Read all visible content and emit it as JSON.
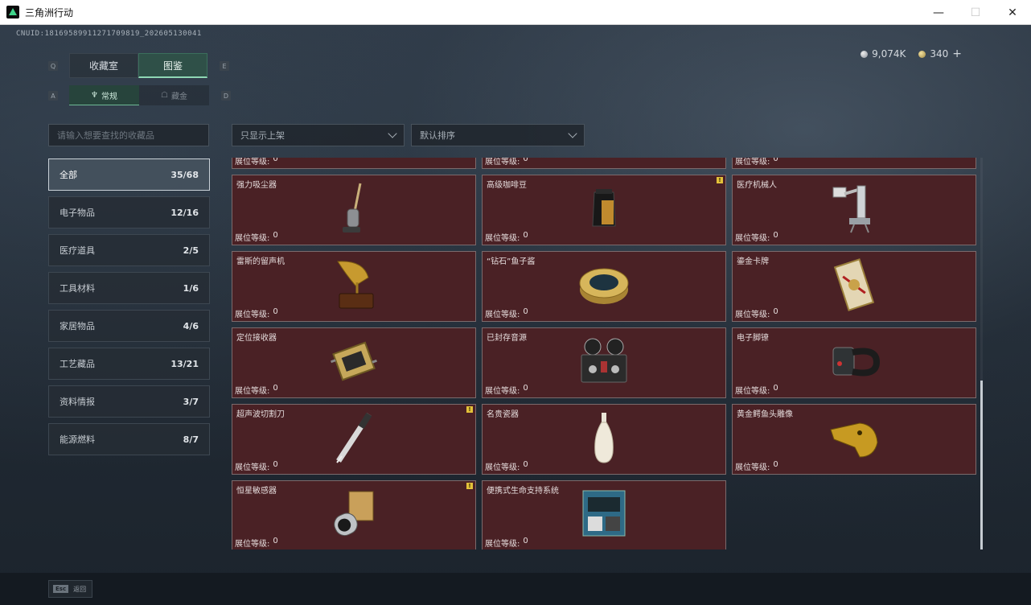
{
  "window": {
    "title": "三角洲行动",
    "minimize": "—",
    "maximize": "☐",
    "close": "✕"
  },
  "header": {
    "uid": "CNUID:18169589911271709819_202605130041"
  },
  "currency": {
    "silver": "9,074K",
    "gold": "340",
    "plus": "+"
  },
  "main_tabs": {
    "left_key": "Q",
    "right_key": "E",
    "items": [
      "收藏室",
      "图鉴"
    ],
    "active": 1
  },
  "sub_tabs": {
    "left_key": "A",
    "right_key": "D",
    "items": [
      "常规",
      "藏金"
    ],
    "active": 0
  },
  "search": {
    "placeholder": "请输入想要查找的收藏品"
  },
  "filters": {
    "shelf": "只显示上架",
    "sort": "默认排序"
  },
  "categories": [
    {
      "label": "全部",
      "count": "35/68"
    },
    {
      "label": "电子物品",
      "count": "12/16"
    },
    {
      "label": "医疗道具",
      "count": "2/5"
    },
    {
      "label": "工具材料",
      "count": "1/6"
    },
    {
      "label": "家居物品",
      "count": "4/6"
    },
    {
      "label": "工艺藏品",
      "count": "13/21"
    },
    {
      "label": "资料情报",
      "count": "3/7"
    },
    {
      "label": "能源燃料",
      "count": "8/7"
    }
  ],
  "grid": {
    "level_label": "展位等级:",
    "stub_row": [
      "0",
      "0",
      "0"
    ],
    "items": [
      {
        "name": "强力吸尘器",
        "level": "0",
        "badge": false,
        "icon": "vacuum-icon"
      },
      {
        "name": "高级咖啡豆",
        "level": "0",
        "badge": true,
        "icon": "coffee-bag-icon"
      },
      {
        "name": "医疗机械人",
        "level": "0",
        "badge": false,
        "icon": "robot-arm-icon"
      },
      {
        "name": "雷斯的留声机",
        "level": "0",
        "badge": false,
        "icon": "gramophone-icon"
      },
      {
        "name": "“钻石”鱼子酱",
        "level": "0",
        "badge": false,
        "icon": "caviar-tin-icon"
      },
      {
        "name": "鎏金卡牌",
        "level": "0",
        "badge": false,
        "icon": "gold-card-icon"
      },
      {
        "name": "定位接收器",
        "level": "0",
        "badge": false,
        "icon": "receiver-icon"
      },
      {
        "name": "已封存音源",
        "level": "0",
        "badge": false,
        "icon": "tape-recorder-icon"
      },
      {
        "name": "电子脚镣",
        "level": "0",
        "badge": false,
        "icon": "ankle-monitor-icon"
      },
      {
        "name": "超声波切割刀",
        "level": "0",
        "badge": true,
        "icon": "ultrasonic-cutter-icon"
      },
      {
        "name": "名贵瓷器",
        "level": "0",
        "badge": false,
        "icon": "porcelain-vase-icon"
      },
      {
        "name": "黄金鳄鱼头雕像",
        "level": "0",
        "badge": false,
        "icon": "gold-crocodile-icon"
      },
      {
        "name": "恒星敏感器",
        "level": "0",
        "badge": true,
        "icon": "star-sensor-icon"
      },
      {
        "name": "便携式生命支持系统",
        "level": "0",
        "badge": false,
        "icon": "life-support-icon"
      }
    ],
    "badge_text": "!"
  },
  "footer": {
    "esc_key": "Esc",
    "esc_label": "返回"
  },
  "colors": {
    "card_bg": "#4a2125",
    "accent": "#8fd7b4",
    "badge": "#e3c13a"
  }
}
